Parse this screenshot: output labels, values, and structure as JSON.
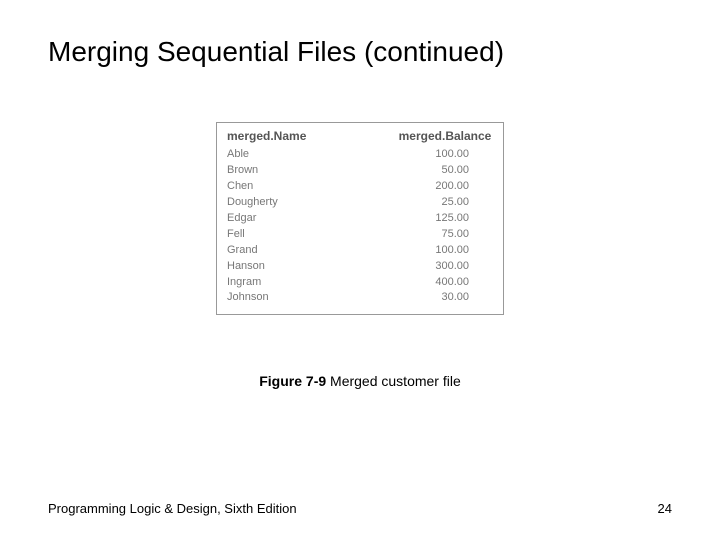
{
  "title": "Merging Sequential Files (continued)",
  "table": {
    "headers": {
      "name": "merged.Name",
      "balance": "merged.Balance"
    },
    "rows": [
      {
        "name": "Able",
        "balance": "100.00"
      },
      {
        "name": "Brown",
        "balance": "50.00"
      },
      {
        "name": "Chen",
        "balance": "200.00"
      },
      {
        "name": "Dougherty",
        "balance": "25.00"
      },
      {
        "name": "Edgar",
        "balance": "125.00"
      },
      {
        "name": "Fell",
        "balance": "75.00"
      },
      {
        "name": "Grand",
        "balance": "100.00"
      },
      {
        "name": "Hanson",
        "balance": "300.00"
      },
      {
        "name": "Ingram",
        "balance": "400.00"
      },
      {
        "name": "Johnson",
        "balance": "30.00"
      }
    ]
  },
  "figure": {
    "label": "Figure 7-9",
    "text": "  Merged customer file"
  },
  "footer": {
    "left": "Programming Logic & Design, Sixth Edition",
    "right": "24"
  }
}
